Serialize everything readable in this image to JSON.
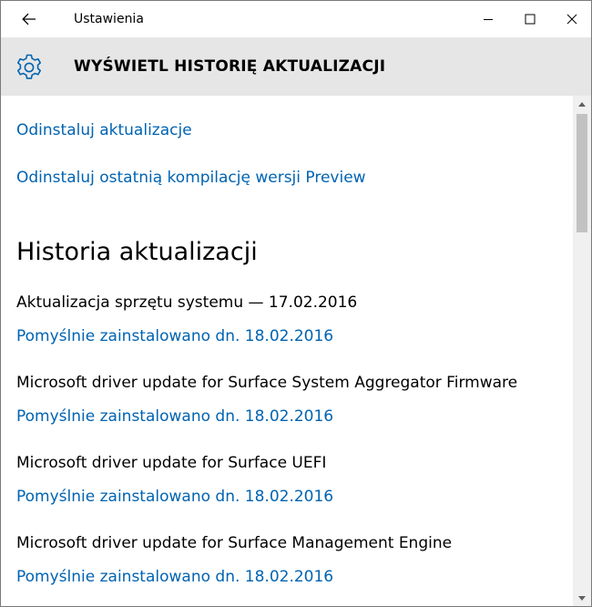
{
  "window": {
    "title": "Ustawienia"
  },
  "header": {
    "title": "WYŚWIETL HISTORIĘ AKTUALIZACJI"
  },
  "links": {
    "uninstall_updates": "Odinstaluj aktualizacje",
    "uninstall_preview": "Odinstaluj ostatnią kompilację wersji Preview"
  },
  "history": {
    "title": "Historia aktualizacji",
    "items": [
      {
        "name": "Aktualizacja sprzętu systemu — 17.02.2016",
        "status": "Pomyślnie zainstalowano dn. 18.02.2016"
      },
      {
        "name": "Microsoft driver update for Surface System Aggregator Firmware",
        "status": "Pomyślnie zainstalowano dn. 18.02.2016"
      },
      {
        "name": "Microsoft driver update for Surface UEFI",
        "status": "Pomyślnie zainstalowano dn. 18.02.2016"
      },
      {
        "name": "Microsoft driver update for Surface Management Engine",
        "status": "Pomyślnie zainstalowano dn. 18.02.2016"
      }
    ]
  },
  "icons": {
    "back": "back-arrow-icon",
    "gear": "gear-icon",
    "minimize": "minimize-icon",
    "maximize": "maximize-icon",
    "close": "close-icon"
  },
  "colors": {
    "accent_link": "#0063b1",
    "header_bg": "#e6e6e6",
    "text": "#000000"
  }
}
